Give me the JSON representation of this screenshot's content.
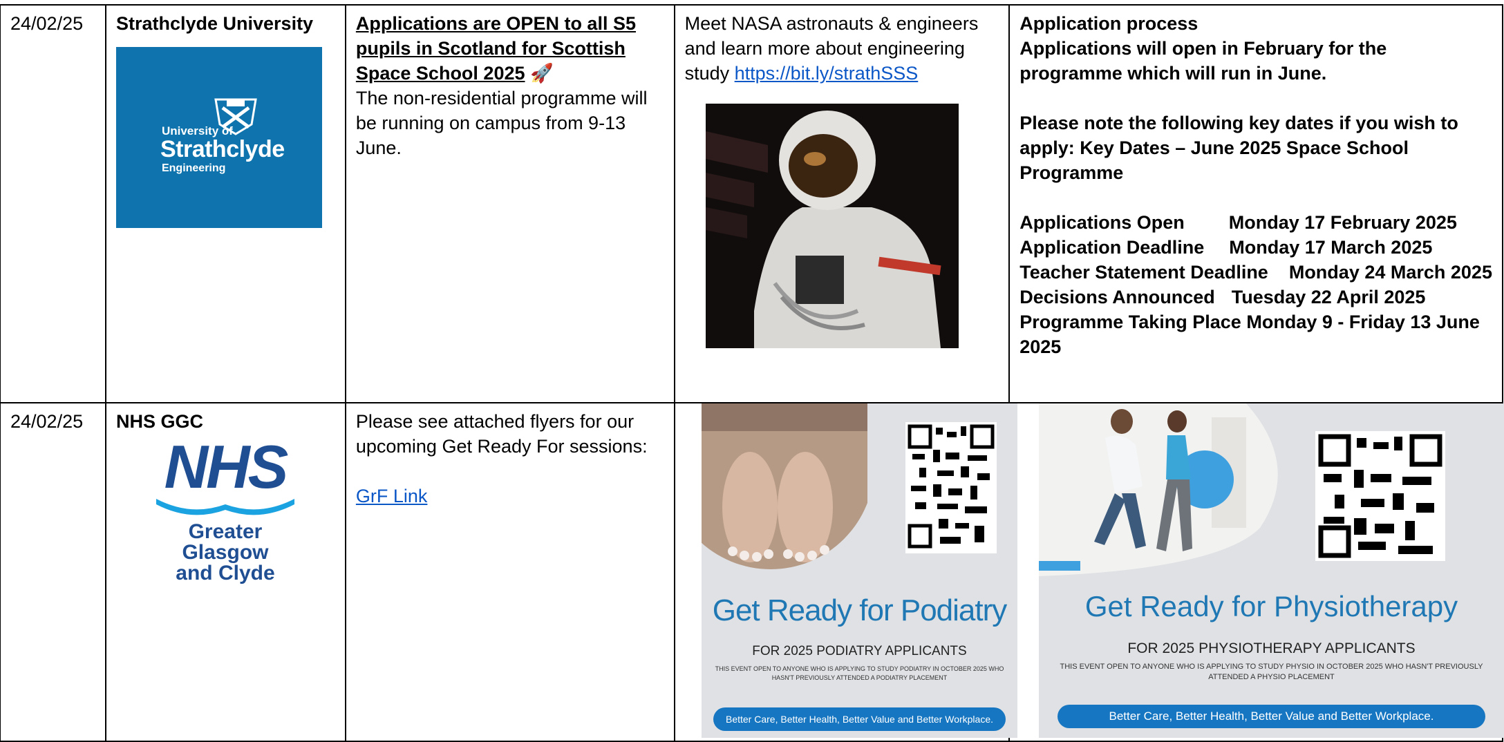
{
  "rows": [
    {
      "date": "24/02/25",
      "org": "Strathclyde University",
      "logo": {
        "line1": "University of",
        "line2": "Strathclyde",
        "line3": "Engineering"
      },
      "info": {
        "headline": "Applications are OPEN to all S5 pupils in Scotland for Scottish Space School 2025",
        "rocket": "🚀",
        "body": "The non-residential programme will be running on campus from 9-13 June."
      },
      "detail": {
        "text": "Meet NASA astronauts & engineers and learn more about engineering study",
        "link": "https://bit.ly/strathSSS"
      },
      "process": {
        "heading": "Application process",
        "intro": "Applications will open in February for the programme which will run in June.",
        "note": "Please note the following key dates if you wish to apply: Key Dates – June 2025 Space School Programme",
        "dates": [
          {
            "label": "Applications Open",
            "value": "Monday 17 February 2025"
          },
          {
            "label": "Application Deadline",
            "value": "Monday 17 March 2025"
          },
          {
            "label": "Teacher Statement Deadline",
            "value": "Monday 24 March 2025"
          },
          {
            "label": "Decisions Announced",
            "value": "Tuesday 22 April 2025"
          },
          {
            "label": "Programme Taking Place",
            "value": "Monday 9 - Friday 13 June 2025"
          }
        ]
      }
    },
    {
      "date": "24/02/25",
      "org": "NHS GGC",
      "logo": {
        "line1": "NHS",
        "line2": "Greater Glasgow",
        "line3": "and Clyde"
      },
      "info": {
        "body": "Please see attached flyers for our upcoming Get Ready For sessions:",
        "link": "GrF Link"
      },
      "flyer1": {
        "title": "Get Ready for Podiatry",
        "for": "FOR 2025 PODIATRY APPLICANTS",
        "small": "THIS EVENT OPEN TO ANYONE WHO IS APPLYING TO STUDY PODIATRY IN OCTOBER 2025 WHO HASN'T PREVIOUSLY ATTENDED A PODIATRY PLACEMENT",
        "pill": "Better Care, Better Health, Better Value and Better Workplace."
      },
      "flyer2": {
        "title": "Get Ready for Physiotherapy",
        "for": "FOR 2025 PHYSIOTHERAPY APPLICANTS",
        "small": "THIS EVENT OPEN TO ANYONE WHO IS APPLYING TO STUDY PHYSIO IN OCTOBER 2025 WHO HASN'T PREVIOUSLY ATTENDED A PHYSIO PLACEMENT",
        "pill": "Better Care, Better Health, Better Value and Better Workplace."
      }
    }
  ]
}
